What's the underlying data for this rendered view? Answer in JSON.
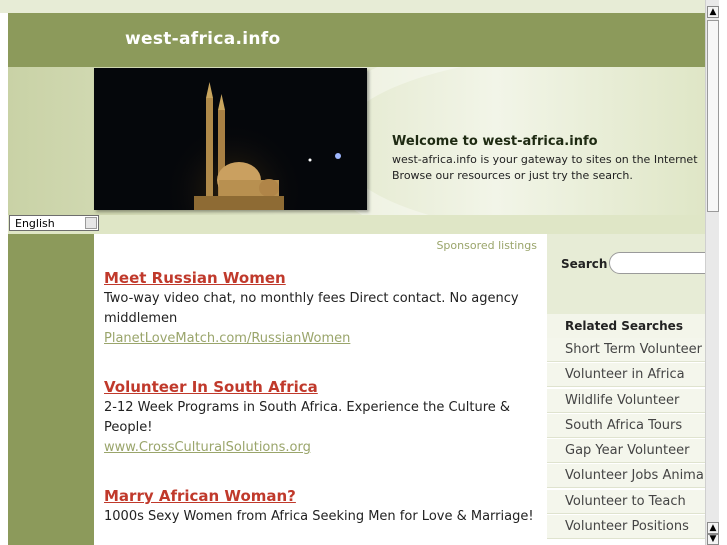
{
  "header": {
    "site_title": "west-africa.info",
    "welcome_title": "Welcome to west-africa.info",
    "welcome_line1": "west-africa.info is your gateway to sites on the Internet",
    "welcome_line2": "Browse our resources or just try the search."
  },
  "language": {
    "selected": "English"
  },
  "main": {
    "sponsored_label": "Sponsored listings",
    "ads": [
      {
        "title": "Meet Russian Women",
        "desc": "Two-way video chat, no monthly fees Direct contact. No agency middlemen",
        "url": "PlanetLoveMatch.com/RussianWomen"
      },
      {
        "title": "Volunteer In South Africa",
        "desc": "2-12 Week Programs in South Africa. Experience the Culture & People!",
        "url": "www.CrossCulturalSolutions.org"
      },
      {
        "title": "Marry African Woman?",
        "desc": "1000s Sexy Women from Africa Seeking Men for Love & Marriage!",
        "url": ""
      }
    ]
  },
  "sidebar": {
    "search_label": "Search",
    "search_value": "",
    "related_heading": "Related Searches",
    "related": [
      "Short Term Volunteer",
      "Volunteer in Africa",
      "Wildlife Volunteer",
      "South Africa Tours",
      "Gap Year Volunteer",
      "Volunteer Jobs Animal",
      "Volunteer to Teach",
      "Volunteer Positions"
    ]
  },
  "icons": {
    "scroll_up": "scroll-up-arrow-icon",
    "scroll_down": "scroll-down-arrow-icon",
    "dropdown": "chevron-down-icon"
  },
  "colors": {
    "header_green": "#8c9a5b",
    "link_red": "#c0392b",
    "url_green": "#9aa56b"
  }
}
